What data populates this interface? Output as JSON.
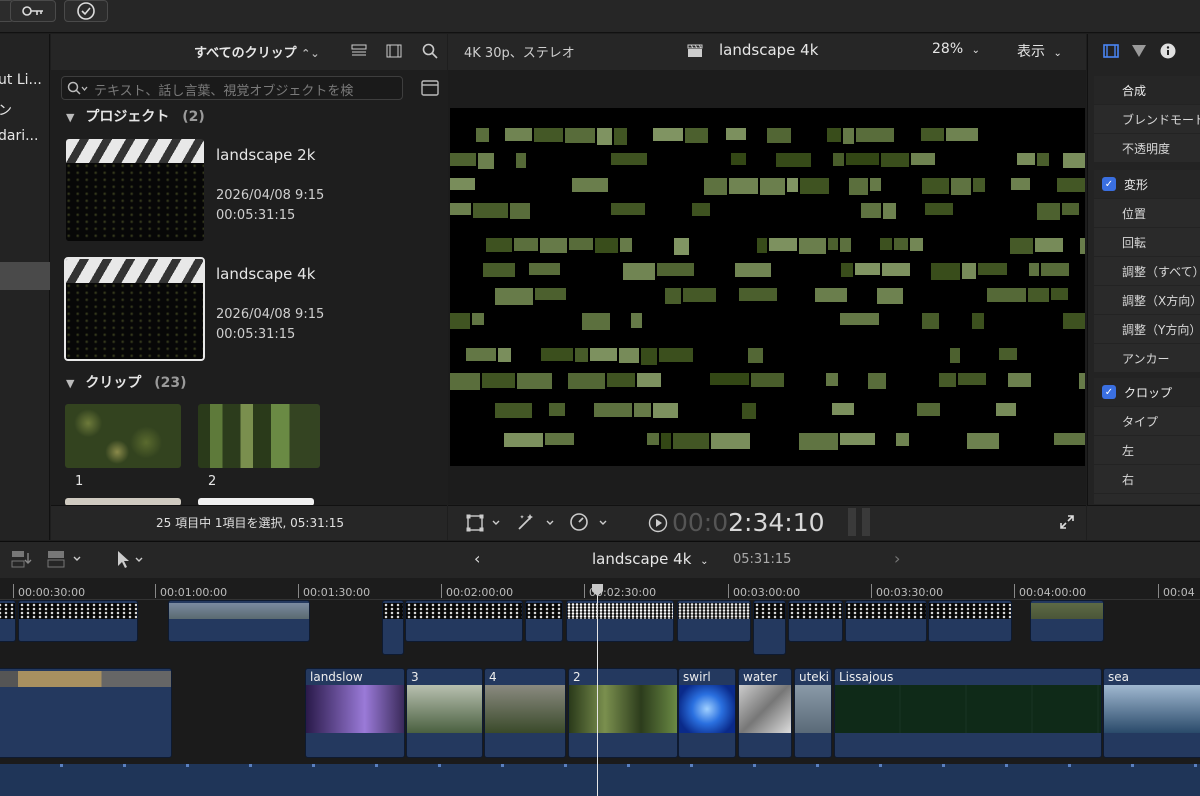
{
  "sidebar": {
    "items": [
      "ut Li...",
      "ン",
      "dari..."
    ]
  },
  "browser": {
    "filter_label": "すべてのクリップ",
    "search_placeholder": "テキスト、話し言葉、視覚オブジェクトを検",
    "projects": {
      "label": "プロジェクト",
      "count": "(2)",
      "items": [
        {
          "name": "landscape 2k",
          "date": "2026/04/08 9:15",
          "duration": "00:05:31:15"
        },
        {
          "name": "landscape 4k",
          "date": "2026/04/08 9:15",
          "duration": "00:05:31:15"
        }
      ]
    },
    "clips": {
      "label": "クリップ",
      "count": "(23)",
      "items": [
        "1",
        "2"
      ]
    },
    "status": "25 項目中 1項目を選択, 05:31:15"
  },
  "viewer": {
    "format": "4K 30p、ステレオ",
    "title": "landscape 4k",
    "zoom": "28%",
    "view_label": "表示",
    "timecode_leading": "00:0",
    "timecode_value": "2:34:10"
  },
  "inspector": {
    "compositing": "合成",
    "blend_mode": "ブレンドモード",
    "opacity": "不透明度",
    "transform": "変形",
    "position": "位置",
    "rotation": "回転",
    "scale_all": "調整（すべて）",
    "scale_x": "調整（X方向）",
    "scale_y": "調整（Y方向）",
    "anchor": "アンカー",
    "crop": "クロップ",
    "type": "タイプ",
    "left": "左",
    "right": "右"
  },
  "timeline": {
    "project": "landscape 4k",
    "duration": "05:31:15",
    "ruler_labels": [
      "00:00:30:00",
      "00:01:00:00",
      "00:01:30:00",
      "00:02:00:00",
      "00:02:30:00",
      "00:03:00:00",
      "00:03:30:00",
      "00:04:00:00",
      "00:04"
    ],
    "primary_clips": [
      "landslow",
      "3",
      "4",
      "2",
      "swirl",
      "water",
      "uteki",
      "Lissajous",
      "sea"
    ]
  },
  "colors": {
    "accent": "#3a6fe0",
    "clip_blue": "#24395f",
    "playhead": "#e6e6e6"
  }
}
